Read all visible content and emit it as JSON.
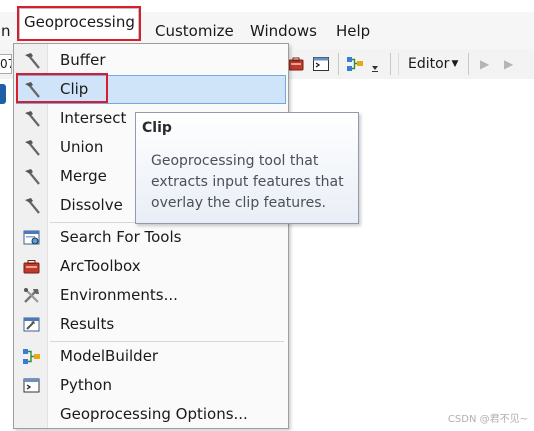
{
  "menubar": {
    "items": [
      {
        "label": "n"
      },
      {
        "label": "Geoprocessing"
      },
      {
        "label": "Customize"
      },
      {
        "label": "Windows"
      },
      {
        "label": "Help"
      }
    ]
  },
  "toolbar": {
    "edge_text": "07",
    "editor_label": "Editor",
    "icons": [
      "arctoolbox-icon",
      "python-window-icon",
      "modelbuilder-icon",
      "toolbar-options-icon",
      "edit-tool-icon",
      "edit-annotation-icon"
    ]
  },
  "dropdown": {
    "items": [
      {
        "label": "Buffer",
        "icon": "hammer-icon"
      },
      {
        "label": "Clip",
        "icon": "hammer-icon",
        "highlighted": true
      },
      {
        "label": "Intersect",
        "icon": "hammer-icon"
      },
      {
        "label": "Union",
        "icon": "hammer-icon"
      },
      {
        "label": "Merge",
        "icon": "hammer-icon"
      },
      {
        "label": "Dissolve",
        "icon": "hammer-icon"
      },
      {
        "label": "Search For Tools",
        "icon": "search-window-icon"
      },
      {
        "label": "ArcToolbox",
        "icon": "toolbox-icon"
      },
      {
        "label": "Environments...",
        "icon": "environments-icon"
      },
      {
        "label": "Results",
        "icon": "results-icon"
      },
      {
        "label": "ModelBuilder",
        "icon": "modelbuilder-icon"
      },
      {
        "label": "Python",
        "icon": "python-icon"
      },
      {
        "label": "Geoprocessing Options...",
        "icon": ""
      }
    ]
  },
  "tooltip": {
    "title": "Clip",
    "body": "Geoprocessing tool that extracts input features that overlay the clip features."
  },
  "watermark": "CSDN @君不见~",
  "colors": {
    "annotation_red": "#d81e2c",
    "hover_fill": "#cfe4f9",
    "hover_border": "#73a9e0"
  }
}
